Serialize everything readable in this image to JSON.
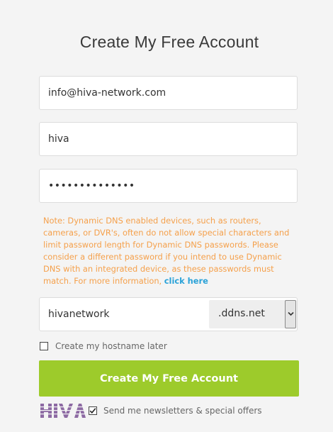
{
  "page": {
    "title": "Create My Free Account"
  },
  "form": {
    "email_value": "info@hiva-network.com",
    "username_value": "hiva",
    "password_masked": "••••••••••••••",
    "note_text": "Note: Dynamic DNS enabled devices, such as routers, cameras, or DVR's, often do not allow special characters and limit password length for Dynamic DNS passwords. Please consider a different password if you intend to use Dynamic DNS with an integrated device, as these passwords must match. For more information, ",
    "note_link": "click here",
    "hostname_value": "hivanetwork",
    "domain_selected": ".ddns.net",
    "hostname_later_label": "Create my hostname later",
    "submit_label": "Create My Free Account",
    "newsletter_label": "Send me newsletters & special offers",
    "logo_text": "HIVA"
  },
  "colors": {
    "accent_green": "#9dcb2b",
    "note_orange": "#f5a04b",
    "link_blue": "#2aa2d8",
    "logo_purple": "#8d6aa3"
  },
  "icons": {
    "dropdown": "chevron-down-icon",
    "check": "checkmark-icon"
  }
}
